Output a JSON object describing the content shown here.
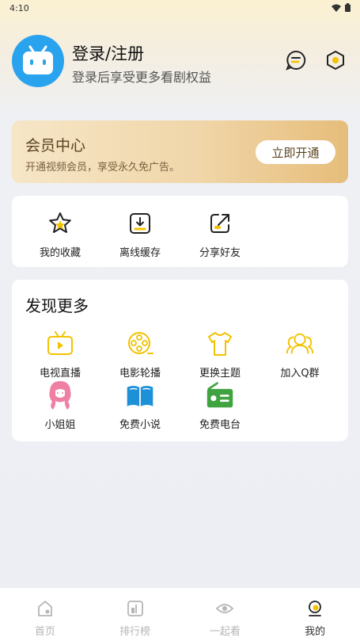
{
  "status": {
    "time": "4:10"
  },
  "profile": {
    "title": "登录/注册",
    "subtitle": "登录后享受更多看剧权益"
  },
  "vip": {
    "title": "会员中心",
    "subtitle": "开通视频会员，享受永久免广告。",
    "button": "立即开通"
  },
  "quick": [
    {
      "label": "我的收藏",
      "icon": "star-icon"
    },
    {
      "label": "离线缓存",
      "icon": "download-icon"
    },
    {
      "label": "分享好友",
      "icon": "share-icon"
    }
  ],
  "discover": {
    "title": "发现更多",
    "items": [
      {
        "label": "电视直播",
        "icon": "tv-icon"
      },
      {
        "label": "电影轮播",
        "icon": "film-reel-icon"
      },
      {
        "label": "更换主题",
        "icon": "shirt-icon"
      },
      {
        "label": "加入Q群",
        "icon": "group-icon"
      },
      {
        "label": "小姐姐",
        "icon": "girl-icon"
      },
      {
        "label": "免费小说",
        "icon": "book-icon"
      },
      {
        "label": "免费电台",
        "icon": "radio-icon"
      }
    ]
  },
  "tabs": [
    {
      "label": "首页",
      "icon": "home-icon",
      "active": false
    },
    {
      "label": "排行榜",
      "icon": "ranking-icon",
      "active": false
    },
    {
      "label": "一起看",
      "icon": "eye-icon",
      "active": false
    },
    {
      "label": "我的",
      "icon": "profile-icon",
      "active": true
    }
  ],
  "colors": {
    "accent": "#f2c200",
    "avatar": "#2aa3ee",
    "vip_text": "#5b4320",
    "book_blue": "#1e90d8",
    "radio_green": "#3fa33f",
    "girl_pink": "#f07fa4"
  }
}
